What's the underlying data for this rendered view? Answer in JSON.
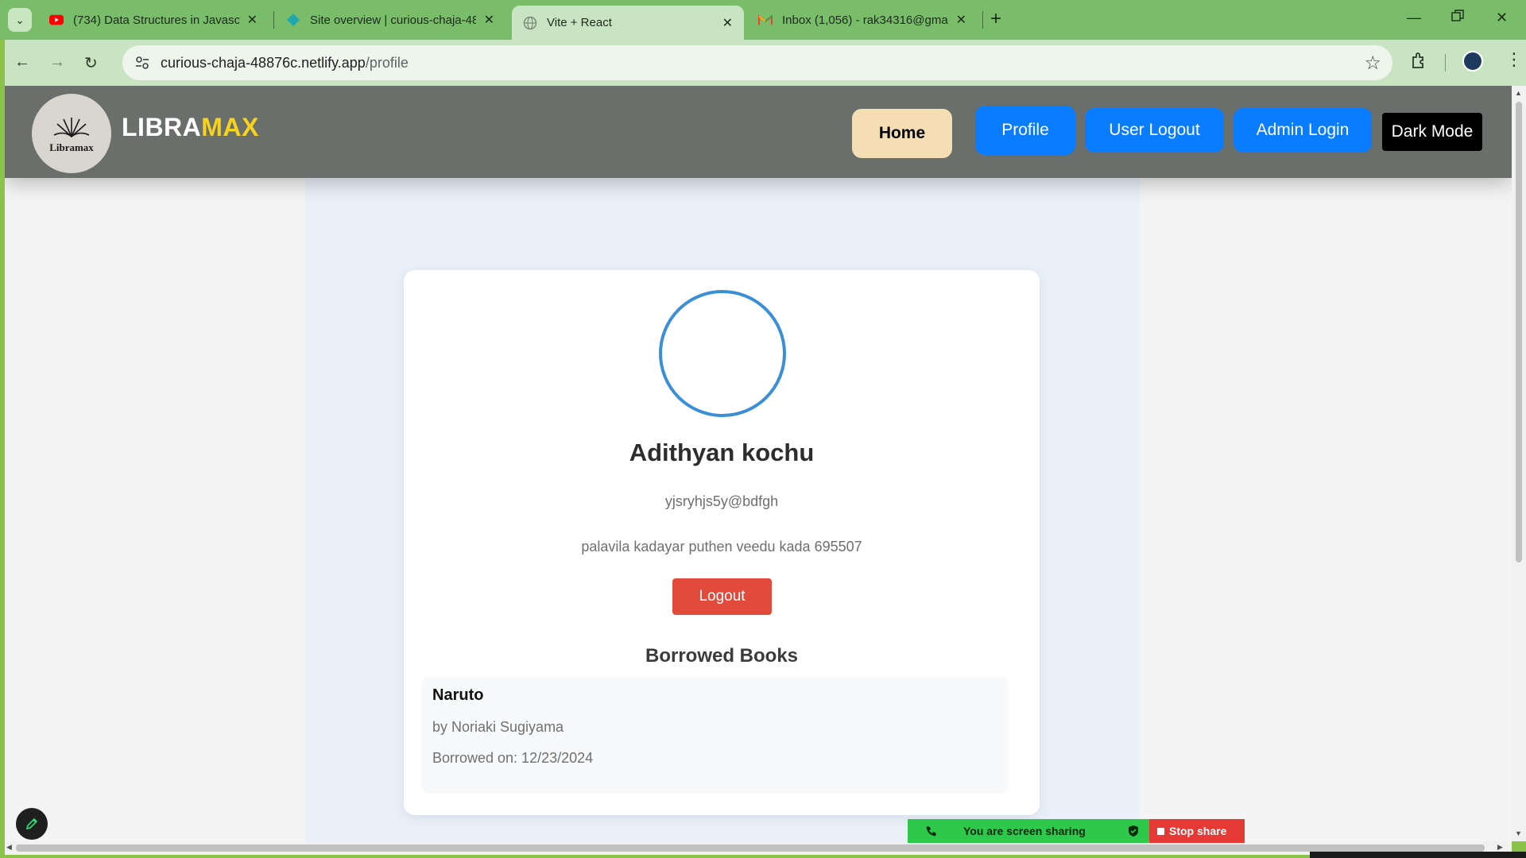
{
  "browser": {
    "tabs": [
      {
        "title": "(734) Data Structures in Javascrip",
        "favicon": "youtube-icon",
        "active": false
      },
      {
        "title": "Site overview | curious-chaja-48",
        "favicon": "netlify-icon",
        "active": false
      },
      {
        "title": "Vite + React",
        "favicon": "globe-icon",
        "active": true
      },
      {
        "title": "Inbox (1,056) - rak34316@gmail",
        "favicon": "gmail-icon",
        "active": false
      }
    ],
    "url_host": "curious-chaja-48876c.netlify.app",
    "url_path": "/profile"
  },
  "header": {
    "logo_text": "Libramax",
    "brand_main": "LIBRA",
    "brand_accent": "MAX",
    "nav": {
      "home": "Home",
      "profile": "Profile",
      "user_logout": "User Logout",
      "admin_login": "Admin Login",
      "dark_mode": "Dark Mode"
    }
  },
  "profile": {
    "name": "Adithyan kochu",
    "email": "yjsryhjs5y@bdfgh",
    "address": "palavila kadayar puthen veedu kada 695507",
    "logout_label": "Logout",
    "borrowed_title": "Borrowed Books",
    "books": [
      {
        "title": "Naruto",
        "author": "by Noriaki Sugiyama",
        "borrowed": "Borrowed on: 12/23/2024"
      }
    ]
  },
  "share_bar": {
    "status": "You are screen sharing",
    "stop": "Stop share"
  },
  "colors": {
    "header_bg": "#6b6f6b",
    "brand_accent": "#f7d21e",
    "primary_button": "#0a7cff",
    "home_button": "#f5deb3",
    "logout_button": "#e24a3b",
    "avatar_ring": "#3a8fd6"
  }
}
